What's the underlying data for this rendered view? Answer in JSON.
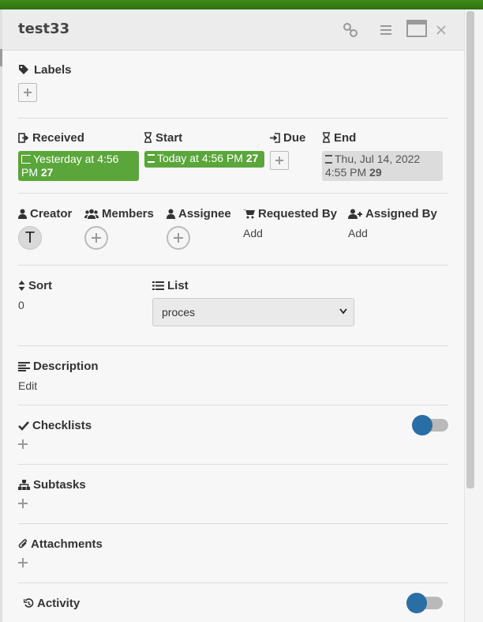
{
  "card": {
    "title": "test33"
  },
  "labels": {
    "heading": "Labels"
  },
  "dates": {
    "received": {
      "heading": "Received",
      "value": "Yesterday at 4:56",
      "value2": "PM",
      "count": "27"
    },
    "start": {
      "heading": "Start",
      "value": "Today at 4:56 PM",
      "count": "27"
    },
    "due": {
      "heading": "Due"
    },
    "end": {
      "heading": "End",
      "value": "Thu, Jul 14, 2022",
      "value2": "4:55 PM",
      "count": "29"
    }
  },
  "people": {
    "creator": {
      "heading": "Creator",
      "avatar_initial": "T"
    },
    "members": {
      "heading": "Members"
    },
    "assignee": {
      "heading": "Assignee"
    },
    "requested_by": {
      "heading": "Requested By",
      "action": "Add"
    },
    "assigned_by": {
      "heading": "Assigned By",
      "action": "Add"
    }
  },
  "sort": {
    "heading": "Sort",
    "value": "0"
  },
  "list": {
    "heading": "List",
    "selected": "proces"
  },
  "description": {
    "heading": "Description",
    "action": "Edit"
  },
  "checklists": {
    "heading": "Checklists",
    "toggle_on": false
  },
  "subtasks": {
    "heading": "Subtasks"
  },
  "attachments": {
    "heading": "Attachments"
  },
  "activity": {
    "heading": "Activity",
    "toggle_on": false
  },
  "colors": {
    "green_badge": "#5aa63a",
    "toggle_knob": "#2a6ea6",
    "top_bar": "#3f8a1a"
  },
  "icons": [
    "link-icon",
    "hamburger-icon",
    "maximize-icon",
    "close-icon",
    "tags-icon",
    "sign-in-icon",
    "hourglass-icon",
    "user-icon",
    "users-icon",
    "cart-icon",
    "user-plus-icon",
    "sort-icon",
    "list-icon",
    "align-left-icon",
    "check-icon",
    "sitemap-icon",
    "paperclip-icon",
    "history-icon"
  ]
}
